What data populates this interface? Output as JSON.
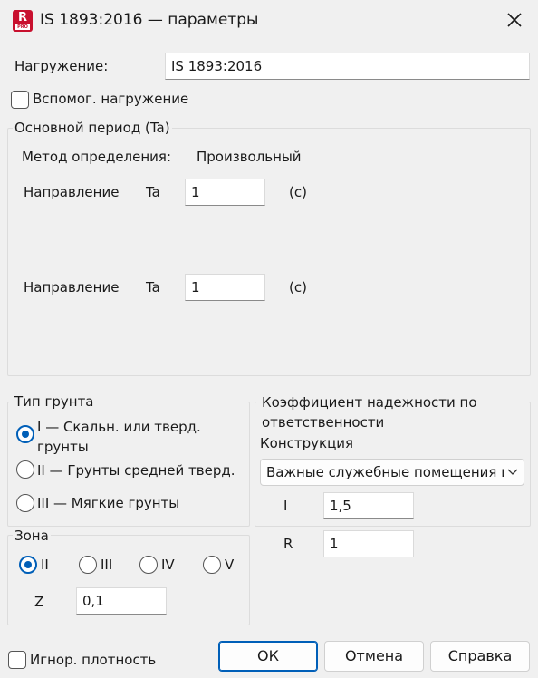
{
  "window": {
    "title": "IS 1893:2016 — параметры",
    "icon_letter": "R",
    "icon_sub": "PRO",
    "close_icon": "close-icon"
  },
  "load": {
    "label": "Нагружение:",
    "value": "IS 1893:2016"
  },
  "aux_load": {
    "label": "Вспомог. нагружение",
    "checked": false
  },
  "period": {
    "title": "Основной период (Ta)",
    "method_label": "Метод определения:",
    "method_value": "Произвольный",
    "rows": [
      {
        "dir_label": "Направление",
        "ta_label": "Ta",
        "value": "1",
        "unit": "(с)"
      },
      {
        "dir_label": "Направление",
        "ta_label": "Ta",
        "value": "1",
        "unit": "(с)"
      }
    ]
  },
  "soil": {
    "title": "Тип грунта",
    "options": [
      {
        "label_line1": "I — Скальн. или тверд.",
        "label_line2": "грунты",
        "selected": true
      },
      {
        "label_line1": "II — Грунты средней тверд.",
        "label_line2": "",
        "selected": false
      },
      {
        "label_line1": "III — Мягкие грунты",
        "label_line2": "",
        "selected": false
      }
    ]
  },
  "zone": {
    "title": "Зона",
    "options": [
      {
        "label": "II",
        "selected": true
      },
      {
        "label": "III",
        "selected": false
      },
      {
        "label": "IV",
        "selected": false
      },
      {
        "label": "V",
        "selected": false
      }
    ],
    "z_label": "Z",
    "z_value": "0,1"
  },
  "importance": {
    "title_line1": "Коэффициент надежности по",
    "title_line2": "ответственности",
    "structure_label": "Конструкция",
    "structure_value": "Важные служебные помещения и",
    "i_label": "I",
    "i_value": "1,5",
    "r_label": "R",
    "r_value": "1"
  },
  "ignore_density": {
    "label": "Игнор. плотность",
    "checked": false
  },
  "buttons": {
    "ok": "ОК",
    "cancel": "Отмена",
    "help": "Справка"
  }
}
